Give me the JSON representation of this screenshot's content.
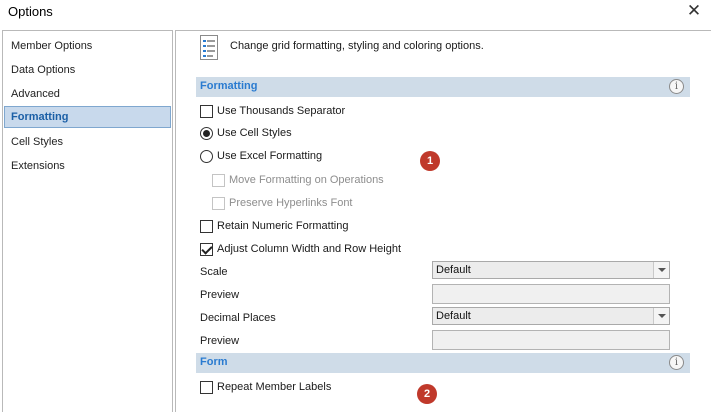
{
  "window": {
    "title": "Options"
  },
  "sidebar": {
    "items": [
      {
        "label": "Member Options"
      },
      {
        "label": "Data Options"
      },
      {
        "label": "Advanced"
      },
      {
        "label": "Formatting"
      },
      {
        "label": "Cell Styles"
      },
      {
        "label": "Extensions"
      }
    ],
    "selected": "Formatting"
  },
  "header": {
    "text": "Change grid formatting, styling and coloring options."
  },
  "formatting": {
    "title": "Formatting",
    "use_thousands_separator": {
      "label": "Use Thousands Separator",
      "checked": false
    },
    "use_cell_styles": {
      "label": "Use Cell Styles",
      "selected": true
    },
    "use_excel_formatting": {
      "label": "Use Excel Formatting",
      "selected": false
    },
    "move_formatting": {
      "label": "Move Formatting on Operations",
      "checked": false,
      "enabled": false
    },
    "preserve_hyperlinks": {
      "label": "Preserve Hyperlinks Font",
      "checked": false,
      "enabled": false
    },
    "retain_numeric": {
      "label": "Retain Numeric Formatting",
      "checked": false
    },
    "adjust_column_width": {
      "label": "Adjust Column Width and Row Height",
      "checked": true
    },
    "scale": {
      "label": "Scale",
      "value": "Default"
    },
    "scale_preview": {
      "label": "Preview",
      "value": ""
    },
    "decimal_places": {
      "label": "Decimal Places",
      "value": "Default"
    },
    "decimal_preview": {
      "label": "Preview",
      "value": ""
    }
  },
  "form": {
    "title": "Form",
    "repeat_member_labels": {
      "label": "Repeat Member Labels",
      "checked": false
    }
  },
  "annotations": {
    "badge1": "1",
    "badge2": "2"
  },
  "colors": {
    "section_bar": "#cfdce8",
    "section_title": "#2a7bd0",
    "selected_item_bg": "#c8d9ec",
    "selected_item_text": "#1b5fa6",
    "badge": "#c0392b"
  },
  "icons": {
    "close": "close-icon",
    "header": "options-document-icon",
    "info": "info-icon"
  }
}
